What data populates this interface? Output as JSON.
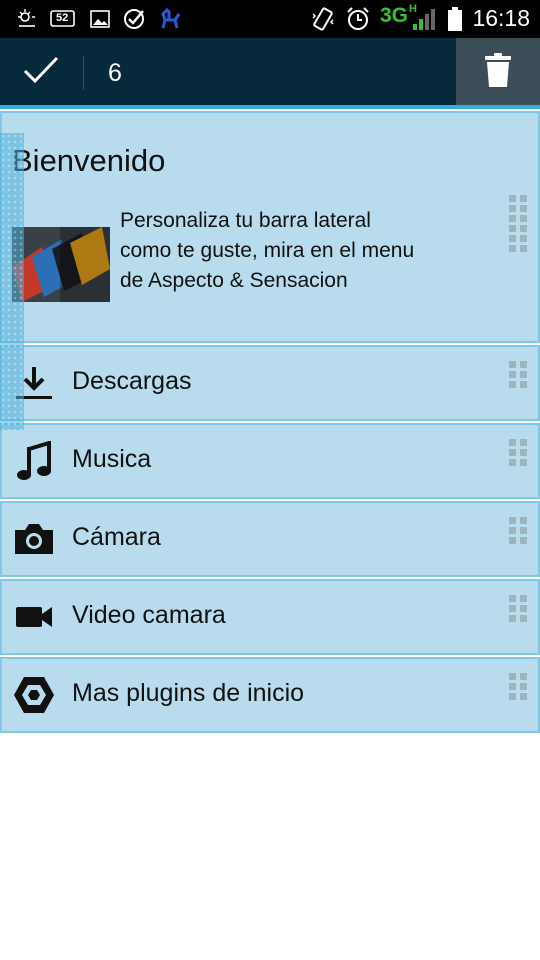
{
  "status_bar": {
    "time": "16:18",
    "network": "3G",
    "network_sub": "H",
    "notification_badge": "52",
    "icons": [
      "weather-icon",
      "message-icon",
      "image-icon",
      "check-circle-icon",
      "llama-icon",
      "vibrate-icon",
      "alarm-icon",
      "signal-icon",
      "battery-icon"
    ]
  },
  "action_bar": {
    "selected_count": "6",
    "confirm_icon": "check-icon",
    "delete_icon": "trash-icon"
  },
  "welcome": {
    "title": "Bienvenido",
    "text": "Personaliza tu barra lateral como te guste, mira en el menu de Aspecto & Sensacion"
  },
  "items": [
    {
      "label": "Descargas",
      "icon": "download-icon"
    },
    {
      "label": "Musica",
      "icon": "music-note-icon"
    },
    {
      "label": "Cámara",
      "icon": "camera-icon"
    },
    {
      "label": "Video camara",
      "icon": "video-camera-icon"
    },
    {
      "label": "Mas plugins de inicio",
      "icon": "plugin-hexagon-icon"
    }
  ],
  "colors": {
    "status_bar_bg": "#000000",
    "action_bar_bg": "#062a3c",
    "accent": "#34b0e0",
    "card_bg": "#b8dcee",
    "network_green": "#35c135"
  }
}
